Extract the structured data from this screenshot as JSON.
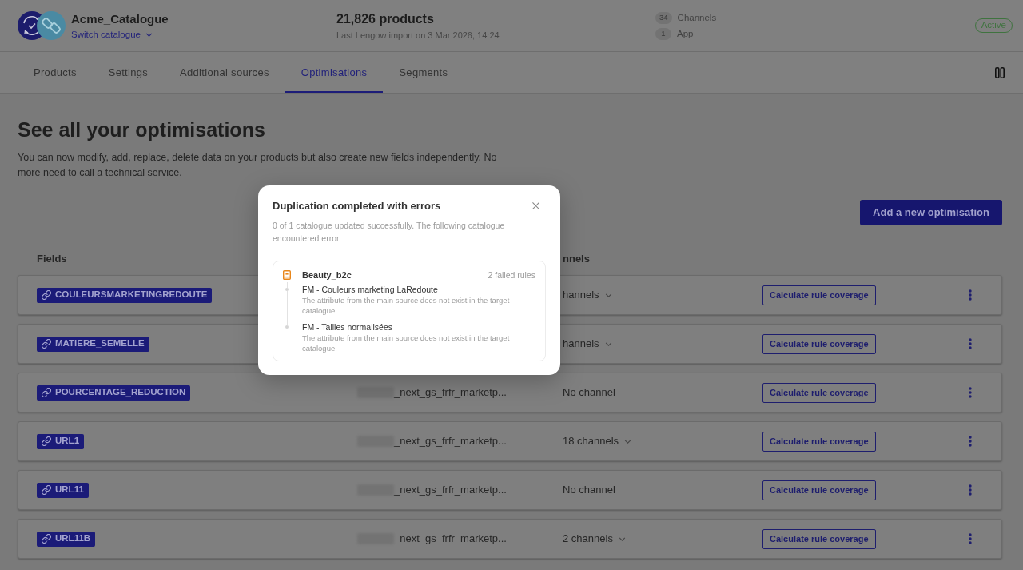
{
  "header": {
    "catalogue": {
      "name": "Acme_Catalogue",
      "switch_label": "Switch catalogue"
    },
    "products": {
      "count": "21,826 products",
      "last_import": "Last Lengow import on 3 Mar 2026, 14:24"
    },
    "connections": [
      {
        "count": "34",
        "label": "Channels"
      },
      {
        "count": "1",
        "label": "App"
      }
    ],
    "status": "Active"
  },
  "tabs": [
    {
      "label": "Products",
      "selected": false
    },
    {
      "label": "Settings",
      "selected": false
    },
    {
      "label": "Additional sources",
      "selected": false
    },
    {
      "label": "Optimisations",
      "selected": true
    },
    {
      "label": "Segments",
      "selected": false
    }
  ],
  "page": {
    "title": "See all your optimisations",
    "description": "You can now modify, add, replace, delete data on your products but also create new fields independently. No more need to call a technical service.",
    "add_button": "Add a new optimisation"
  },
  "table": {
    "fields_header": "Fields",
    "channels_header": "nnels",
    "rows": [
      {
        "field": "COULEURSMARKETINGREDOUTE",
        "channels": "hannels",
        "expandable": true,
        "action": "Calculate rule coverage"
      },
      {
        "field": "MATIERE_SEMELLE",
        "channels": "hannels",
        "expandable": true,
        "action": "Calculate rule coverage"
      },
      {
        "field": "POURCENTAGE_REDUCTION",
        "source": "_next_gs_frfr_marketp...",
        "channels": "No channel",
        "expandable": false,
        "action": "Calculate rule coverage"
      },
      {
        "field": "URL1",
        "source": "_next_gs_frfr_marketp...",
        "channels": "18 channels",
        "expandable": true,
        "action": "Calculate rule coverage"
      },
      {
        "field": "URL11",
        "source": "_next_gs_frfr_marketp...",
        "channels": "No channel",
        "expandable": false,
        "action": "Calculate rule coverage"
      },
      {
        "field": "URL11B",
        "source": "_next_gs_frfr_marketp...",
        "channels": "2 channels",
        "expandable": true,
        "action": "Calculate rule coverage"
      }
    ]
  },
  "dialog": {
    "title": "Duplication completed with errors",
    "message": "0 of 1 catalogue updated successfully. The following catalogue encountered error.",
    "catalogues": [
      {
        "name": "Beauty_b2c",
        "summary": "2 failed rules",
        "rules": [
          {
            "name": "FM - Couleurs marketing LaRedoute",
            "error": "The attribute from the main source does not exist in the target catalogue."
          },
          {
            "name": "FM - Tailles normalisées",
            "error": "The attribute from the main source does not exist in the target catalogue."
          }
        ]
      }
    ]
  }
}
